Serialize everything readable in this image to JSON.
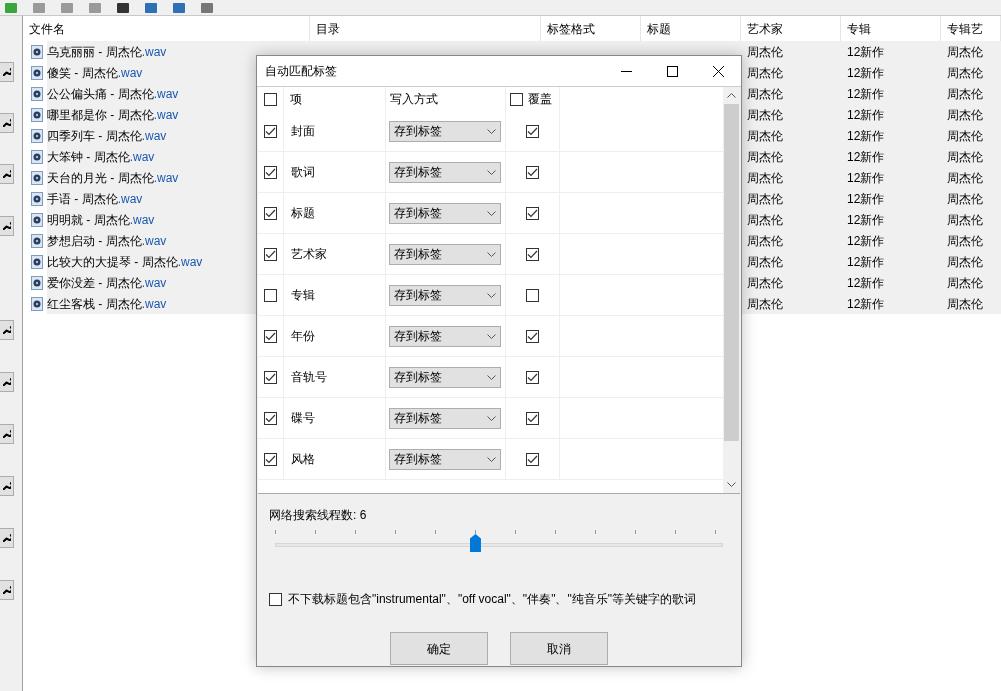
{
  "table": {
    "columns": [
      "文件名",
      "目录",
      "标签格式",
      "标题",
      "艺术家",
      "专辑",
      "专辑艺"
    ],
    "rows": [
      {
        "name": "乌克丽丽 - 周杰伦",
        "extension": ".wav",
        "artist": "周杰伦",
        "album": "12新作",
        "album_artist": "周杰伦"
      },
      {
        "name": "傻笑 - 周杰伦",
        "extension": ".wav",
        "artist": "周杰伦",
        "album": "12新作",
        "album_artist": "周杰伦"
      },
      {
        "name": "公公偏头痛 - 周杰伦",
        "extension": ".wav",
        "artist": "周杰伦",
        "album": "12新作",
        "album_artist": "周杰伦"
      },
      {
        "name": "哪里都是你 - 周杰伦",
        "extension": ".wav",
        "artist": "周杰伦",
        "album": "12新作",
        "album_artist": "周杰伦"
      },
      {
        "name": "四季列车 - 周杰伦",
        "extension": ".wav",
        "artist": "周杰伦",
        "album": "12新作",
        "album_artist": "周杰伦"
      },
      {
        "name": "大笨钟 - 周杰伦",
        "extension": ".wav",
        "artist": "周杰伦",
        "album": "12新作",
        "album_artist": "周杰伦"
      },
      {
        "name": "天台的月光 - 周杰伦",
        "extension": ".wav",
        "artist": "周杰伦",
        "album": "12新作",
        "album_artist": "周杰伦"
      },
      {
        "name": "手语 - 周杰伦",
        "extension": ".wav",
        "artist": "周杰伦",
        "album": "12新作",
        "album_artist": "周杰伦"
      },
      {
        "name": "明明就 - 周杰伦",
        "extension": ".wav",
        "artist": "周杰伦",
        "album": "12新作",
        "album_artist": "周杰伦"
      },
      {
        "name": "梦想启动 - 周杰伦",
        "extension": ".wav",
        "artist": "周杰伦",
        "album": "12新作",
        "album_artist": "周杰伦"
      },
      {
        "name": "比较大的大提琴 - 周杰伦",
        "extension": ".wav",
        "artist": "周杰伦",
        "album": "12新作",
        "album_artist": "周杰伦"
      },
      {
        "name": "爱你没差 - 周杰伦",
        "extension": ".wav",
        "artist": "周杰伦",
        "album": "12新作",
        "album_artist": "周杰伦"
      },
      {
        "name": "红尘客栈 - 周杰伦",
        "extension": ".wav",
        "artist": "周杰伦",
        "album": "12新作",
        "album_artist": "周杰伦"
      }
    ]
  },
  "dialog": {
    "title": "自动匹配标签",
    "header": {
      "select_all_checked": false,
      "item": "项",
      "write_mode": "写入方式",
      "overwrite_label": "覆盖",
      "overwrite_all_checked": false
    },
    "items": [
      {
        "label": "封面",
        "checked": true,
        "mode": "存到标签",
        "overwrite": true
      },
      {
        "label": "歌词",
        "checked": true,
        "mode": "存到标签",
        "overwrite": true
      },
      {
        "label": "标题",
        "checked": true,
        "mode": "存到标签",
        "overwrite": true
      },
      {
        "label": "艺术家",
        "checked": true,
        "mode": "存到标签",
        "overwrite": true
      },
      {
        "label": "专辑",
        "checked": false,
        "mode": "存到标签",
        "overwrite": false
      },
      {
        "label": "年份",
        "checked": true,
        "mode": "存到标签",
        "overwrite": true
      },
      {
        "label": "音轨号",
        "checked": true,
        "mode": "存到标签",
        "overwrite": true
      },
      {
        "label": "碟号",
        "checked": true,
        "mode": "存到标签",
        "overwrite": true
      },
      {
        "label": "风格",
        "checked": true,
        "mode": "存到标签",
        "overwrite": true
      }
    ],
    "threads": {
      "label": "网络搜索线程数: 6",
      "level": 0.4545
    },
    "skip_instrumental": {
      "label": "不下载标题包含\"instrumental\"、\"off vocal\"、\"伴奏\"、\"纯音乐\"等关键字的歌词",
      "checked": false
    },
    "buttons": [
      "确定",
      "取消"
    ]
  }
}
